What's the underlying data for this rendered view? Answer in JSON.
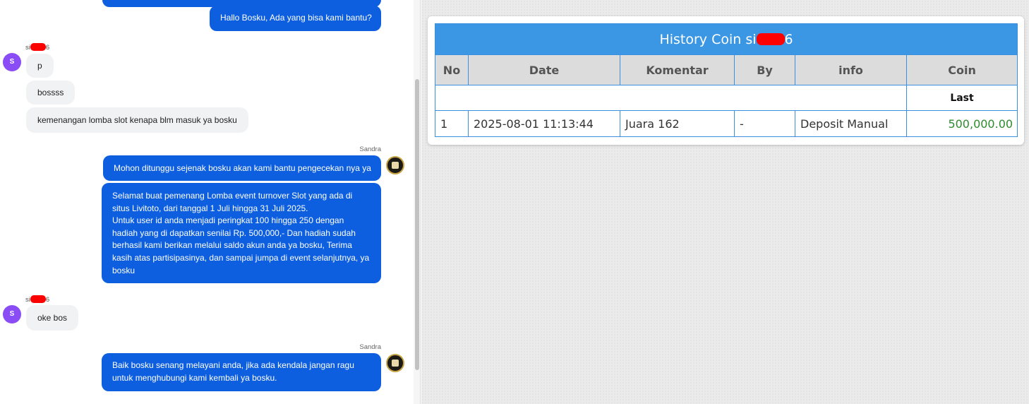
{
  "chat": {
    "greeting_bubble": "Hallo Bosku, Ada yang bisa kami bantu?",
    "user_name_prefix": "si",
    "user_name_suffix": "6",
    "user_avatar_letter": "S",
    "user_messages_1": [
      "p",
      "bossss",
      "kemenangan lomba slot kenapa blm masuk ya bosku"
    ],
    "agent_name": "Sandra",
    "agent_messages_1": [
      "Mohon ditunggu sejenak bosku akan kami bantu pengecekan nya ya",
      "Selamat buat pemenang Lomba event turnover Slot yang ada di situs Livitoto, dari tanggal 1 Juli hingga 31 Juli 2025.\nUntuk user id anda menjadi peringkat 100 hingga 250 dengan hadiah yang di dapatkan senilai Rp. 500,000,- Dan hadiah sudah berhasil kami berikan melalui saldo akun anda ya bosku, Terima kasih atas partisipasinya, dan sampai jumpa di event selanjutnya, ya bosku"
    ],
    "user_messages_2": [
      "oke bos"
    ],
    "agent_messages_2": [
      "Baik bosku senang melayani anda, jika ada kendala jangan ragu untuk menghubungi kami kembali ya bosku."
    ]
  },
  "history": {
    "title_prefix": "History Coin si",
    "title_suffix": "6",
    "columns": [
      "No",
      "Date",
      "Komentar",
      "By",
      "info",
      "Coin"
    ],
    "subheader_last": "Last",
    "rows": [
      {
        "no": "1",
        "date": "2025-08-01 11:13:44",
        "komentar": "Juara 162",
        "by": "-",
        "info": "Deposit Manual",
        "coin": "500,000.00"
      }
    ]
  },
  "colors": {
    "outgoing_bubble": "#0d5fe0",
    "incoming_bubble": "#f1f2f4",
    "table_header_blue": "#3b97e4",
    "coin_green": "#2e8b2e",
    "redaction": "#ff0000"
  }
}
